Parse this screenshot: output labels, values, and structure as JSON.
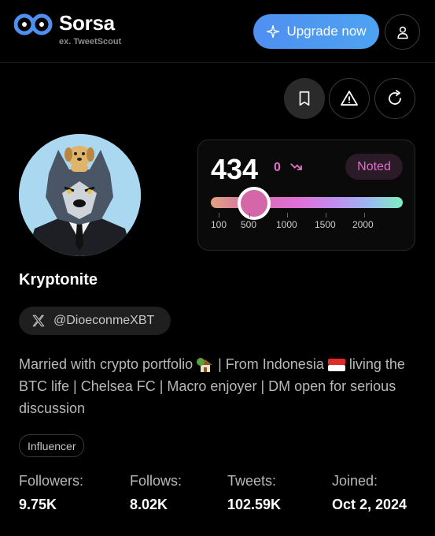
{
  "header": {
    "brand_name": "Sorsa",
    "brand_subtitle": "ex. TweetScout",
    "upgrade_label": "Upgrade now",
    "accent_gradient": [
      "#4f8ff0",
      "#4da3f2"
    ]
  },
  "actions": {
    "bookmark_icon": "bookmark-icon",
    "report_icon": "warning-icon",
    "refresh_icon": "refresh-icon"
  },
  "score": {
    "value": "434",
    "change": "0",
    "trend_icon": "trend-down-icon",
    "badge": "Noted",
    "slider_ticks": [
      "100",
      "500",
      "1000",
      "1500",
      "2000"
    ],
    "accent": "#e070c8"
  },
  "profile": {
    "name": "Kryptonite",
    "handle": "@DioeconmeXBT",
    "bio_parts": [
      "Married with crypto portfolio ",
      " | From Indonesia ",
      " living the BTC life | Chelsea FC | Macro enjoyer | DM open for serious discussion"
    ],
    "tag": "Influencer"
  },
  "stats": [
    {
      "label": "Followers:",
      "value": "9.75K"
    },
    {
      "label": "Follows:",
      "value": "8.02K"
    },
    {
      "label": "Tweets:",
      "value": "102.59K"
    },
    {
      "label": "Joined:",
      "value": "Oct 2, 2024"
    }
  ]
}
